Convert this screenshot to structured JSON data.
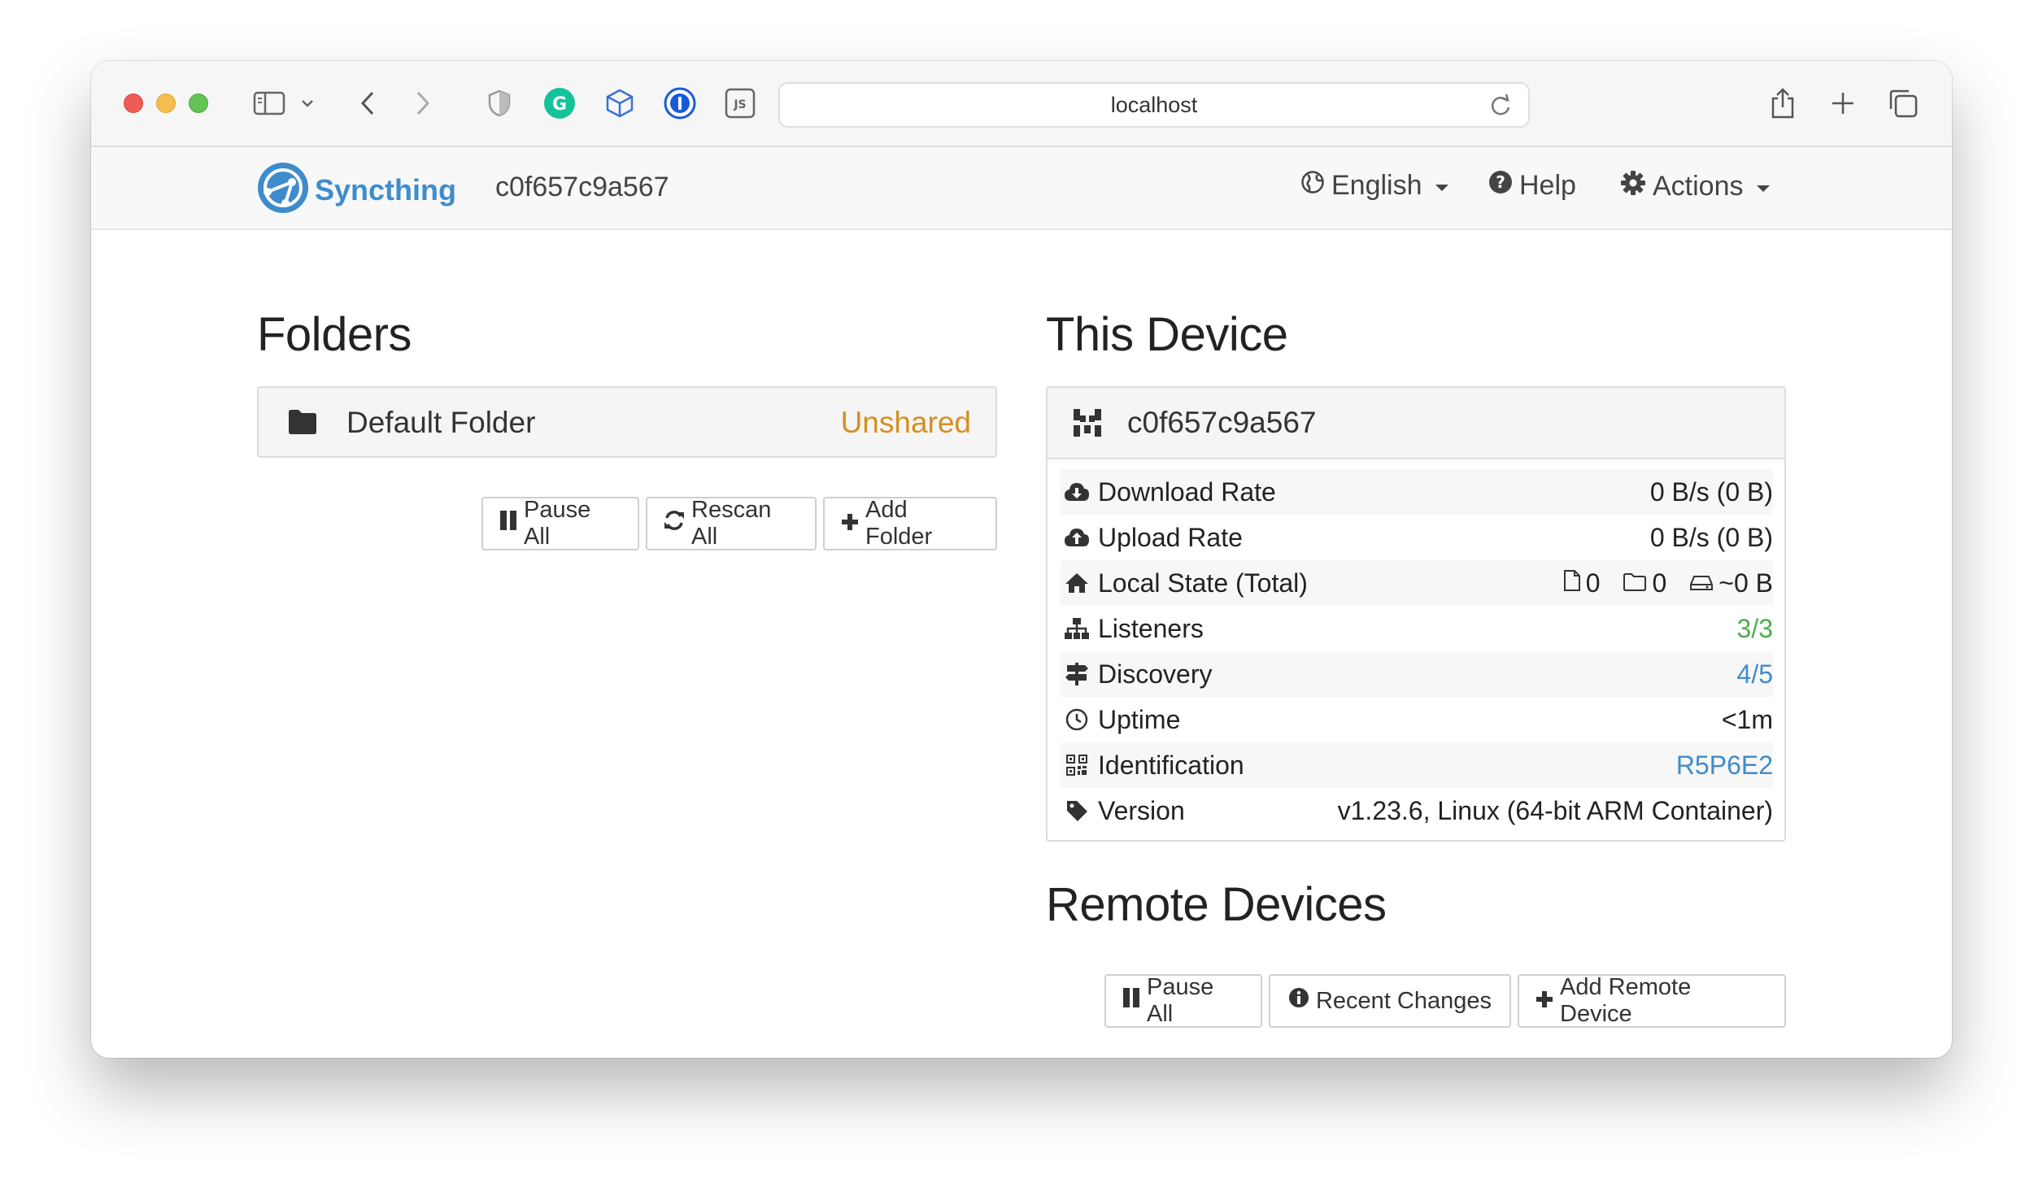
{
  "browser": {
    "url": "localhost"
  },
  "navbar": {
    "brand": "Syncthing",
    "device_name": "c0f657c9a567",
    "language": "English",
    "help": "Help",
    "actions": "Actions"
  },
  "folders": {
    "title": "Folders",
    "items": [
      {
        "name": "Default Folder",
        "state": "Unshared"
      }
    ],
    "buttons": {
      "pause_all": "Pause All",
      "rescan_all": "Rescan All",
      "add_folder": "Add Folder"
    }
  },
  "this_device": {
    "title": "This Device",
    "name": "c0f657c9a567",
    "rows": [
      {
        "label": "Download Rate",
        "value": "0 B/s (0 B)",
        "icon": "cloud-download-icon"
      },
      {
        "label": "Upload Rate",
        "value": "0 B/s (0 B)",
        "icon": "cloud-upload-icon"
      },
      {
        "label": "Local State (Total)",
        "files": "0",
        "dirs": "0",
        "size": "~0 B",
        "icon": "home-icon"
      },
      {
        "label": "Listeners",
        "value": "3/3",
        "icon": "sitemap-icon"
      },
      {
        "label": "Discovery",
        "value": "4/5",
        "icon": "signpost-icon"
      },
      {
        "label": "Uptime",
        "value": "<1m",
        "icon": "clock-icon"
      },
      {
        "label": "Identification",
        "value": "R5P6E2",
        "icon": "qrcode-icon"
      },
      {
        "label": "Version",
        "value": "v1.23.6, Linux (64-bit ARM Container)",
        "icon": "tag-icon"
      }
    ]
  },
  "remote_devices": {
    "title": "Remote Devices",
    "buttons": {
      "pause_all": "Pause All",
      "recent_changes": "Recent Changes",
      "add_remote_device": "Add Remote Device"
    }
  },
  "colors": {
    "brand": "#3e8ccc",
    "unshared": "#d58f23",
    "ok": "#4cae4c",
    "link": "#3e8ccc"
  }
}
